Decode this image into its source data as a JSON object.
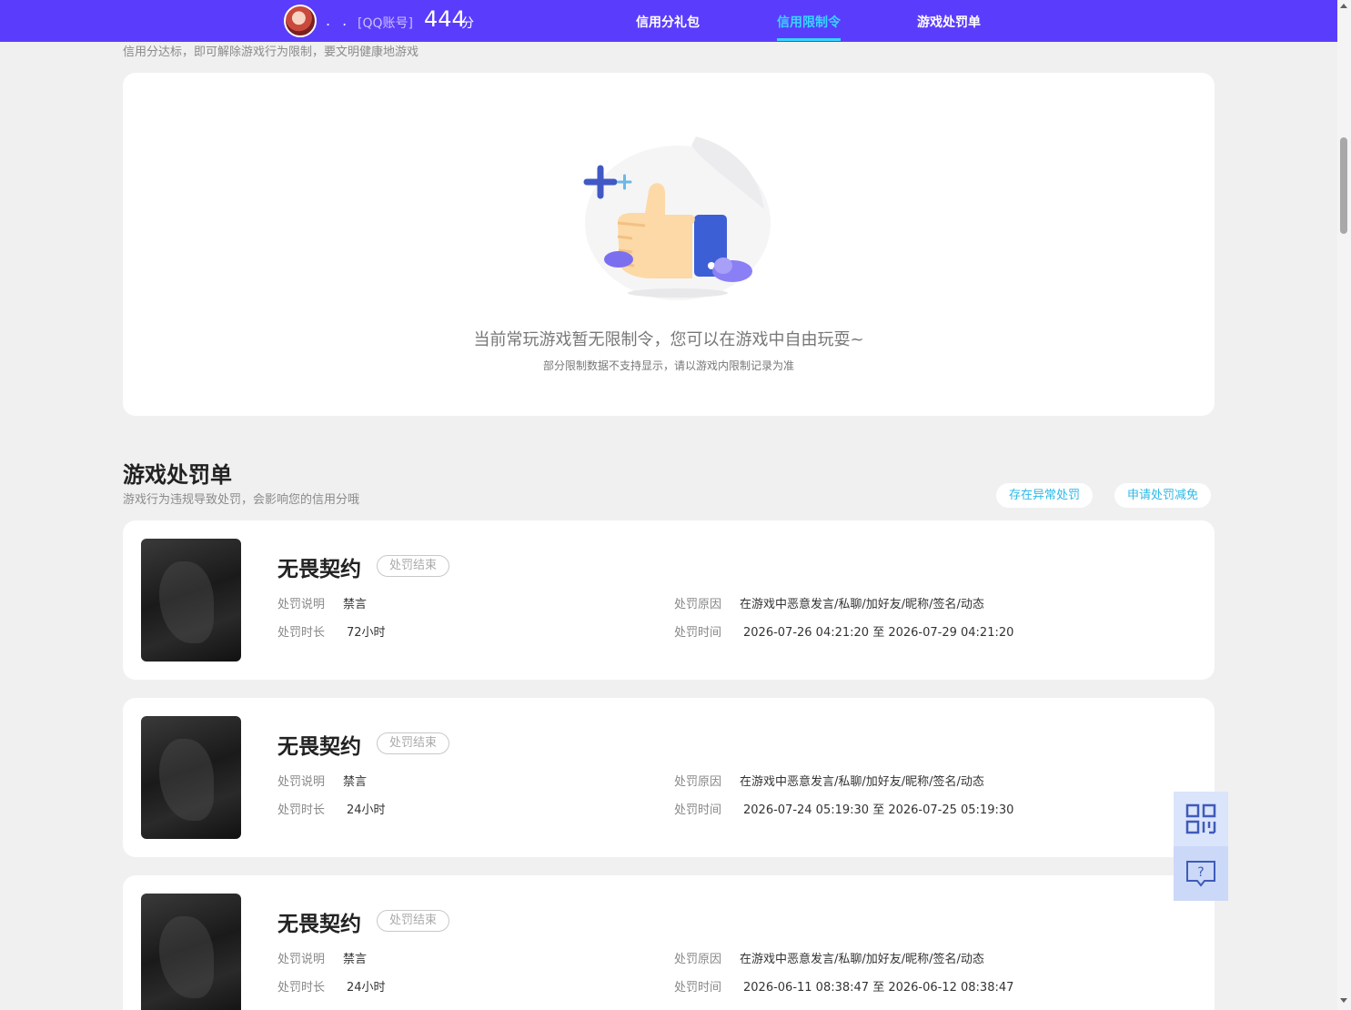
{
  "header": {
    "nickname": ". .",
    "account_label": "[QQ账号]",
    "score": "444",
    "score_unit": "分",
    "nav": [
      {
        "label": "信用分礼包"
      },
      {
        "label": "信用限制令"
      },
      {
        "label": "游戏处罚单"
      }
    ]
  },
  "restriction": {
    "subtitle": "信用分达标，即可解除游戏行为限制，要文明健康地游戏",
    "empty_text": "当前常玩游戏暂无限制令，您可以在游戏中自由玩耍~",
    "empty_note": "部分限制数据不支持显示，请以游戏内限制记录为准"
  },
  "penalties": {
    "title": "游戏处罚单",
    "subtitle": "游戏行为违规导致处罚，会影响您的信用分哦",
    "anomaly_button": "存在异常处罚",
    "reduce_button": "申请处罚减免",
    "labels": {
      "desc": "处罚说明",
      "duration": "处罚时长",
      "reason": "处罚原因",
      "time": "处罚时间"
    },
    "items": [
      {
        "game": "无畏契约",
        "status": "处罚结束",
        "desc": "禁言",
        "duration": "72小时",
        "reason": "在游戏中恶意发言/私聊/加好友/昵称/签名/动态",
        "time": "2026-07-26 04:21:20 至 2026-07-29 04:21:20"
      },
      {
        "game": "无畏契约",
        "status": "处罚结束",
        "desc": "禁言",
        "duration": "24小时",
        "reason": "在游戏中恶意发言/私聊/加好友/昵称/签名/动态",
        "time": "2026-07-24 05:19:30 至 2026-07-25 05:19:30"
      },
      {
        "game": "无畏契约",
        "status": "处罚结束",
        "desc": "禁言",
        "duration": "24小时",
        "reason": "在游戏中恶意发言/私聊/加好友/昵称/签名/动态",
        "time": "2026-06-11 08:38:47 至 2026-06-12 08:38:47"
      }
    ]
  },
  "floating": {
    "qr_icon": "qrcode-icon",
    "help_icon": "help-chat-icon"
  },
  "colors": {
    "header_bg": "#5a3dfc",
    "nav_active": "#36d6ff",
    "pill_text": "#2cb9e8"
  }
}
